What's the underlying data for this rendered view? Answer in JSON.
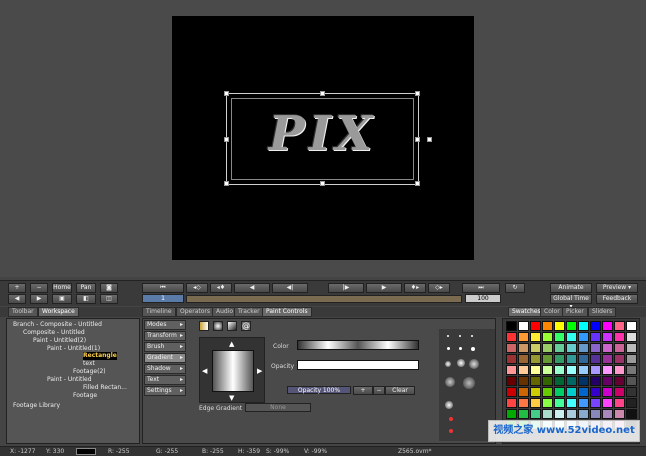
{
  "transport": {
    "plus": "+",
    "minus": "−",
    "home": "Home",
    "pan": "Pan",
    "frame": "1",
    "end_frame": "100",
    "animate": "Animate",
    "preview": "Preview ▾",
    "global_time": "Global Time ▾",
    "feedback": "Feedback"
  },
  "canvas": {
    "artwork_text": "PIX"
  },
  "left_tabs": [
    "Toolbar",
    "Workspace"
  ],
  "center_tabs": [
    "Timeline",
    "Operators",
    "Audio",
    "Tracker",
    "Paint Controls"
  ],
  "right_tabs": [
    "Swatches",
    "Color",
    "Picker",
    "Sliders"
  ],
  "tree": [
    "Branch - Composite - Untitled",
    "Composite - Untitled",
    "Paint - Untitled(2)",
    "Paint - Untitled(1)",
    "Rectangle",
    "text",
    "Footage(2)",
    "Paint - Untitled",
    "Filled Rectan...",
    "Footage",
    "Footage Library"
  ],
  "paint_menu": [
    "Modes",
    "Transform",
    "Brush",
    "Gradient",
    "Shadow",
    "Text",
    "Settings"
  ],
  "paint": {
    "color_label": "Color",
    "opacity_label": "Opacity",
    "opacity_value": "Opacity 100%",
    "clear": "Clear",
    "edge_gradient_label": "Edge Gradient",
    "edge_gradient_value": "None"
  },
  "swatch_colors": [
    "#000000",
    "#ffffff",
    "#ff0000",
    "#ff8800",
    "#ffff00",
    "#00ff00",
    "#00ffff",
    "#0000ff",
    "#ff00ff",
    "#ff6688",
    "#ffffff",
    "#ff3333",
    "#ff9933",
    "#ffee33",
    "#99ff33",
    "#33ff66",
    "#33ffee",
    "#3399ff",
    "#6633ff",
    "#cc33ff",
    "#ff33aa",
    "#dddddd",
    "#cc6666",
    "#cc9966",
    "#cccc66",
    "#99cc66",
    "#66cc99",
    "#66cccc",
    "#6699cc",
    "#8866cc",
    "#cc66cc",
    "#cc6699",
    "#bbbbbb",
    "#993333",
    "#996633",
    "#999933",
    "#669933",
    "#339966",
    "#339999",
    "#336699",
    "#553399",
    "#993399",
    "#993366",
    "#999999",
    "#ff9999",
    "#ffcc99",
    "#ffff99",
    "#ccff99",
    "#99ffcc",
    "#99ffff",
    "#99ccff",
    "#aa99ff",
    "#ff99ff",
    "#ff99cc",
    "#777777",
    "#660000",
    "#663300",
    "#666600",
    "#336600",
    "#006633",
    "#006666",
    "#003366",
    "#220066",
    "#660066",
    "#660033",
    "#555555",
    "#cc0000",
    "#cc6600",
    "#cccc00",
    "#66cc00",
    "#00cc66",
    "#00cccc",
    "#0066cc",
    "#3300cc",
    "#cc00cc",
    "#cc0066",
    "#333333",
    "#ff4444",
    "#ff7744",
    "#ffcc44",
    "#88ff44",
    "#44ff99",
    "#44ffff",
    "#4499ff",
    "#7744ff",
    "#ff44ff",
    "#ff4488",
    "#222222",
    "#00aa00",
    "#22bb44",
    "#44cc88",
    "#aaddcc",
    "#cceeee",
    "#aaccdd",
    "#88aacc",
    "#8888bb",
    "#aa88bb",
    "#cc88aa",
    "#111111",
    "#009900",
    "#00bb22",
    "#66dd99",
    "#bbeeee",
    "#ddffff",
    "#bbddee",
    "#99bbdd",
    "#9999cc",
    "#bb99cc",
    "#dd99bb",
    "#000000"
  ],
  "status": {
    "x": "X: -1277",
    "y": "Y: 330",
    "r": "R: -255",
    "g": "G: -255",
    "b": "B: -255",
    "h": "H: -359",
    "s": "S: -99%",
    "v": "V: -99%",
    "project": "Z565.ovm*"
  },
  "watermark": "视频之家 www.52video.net"
}
